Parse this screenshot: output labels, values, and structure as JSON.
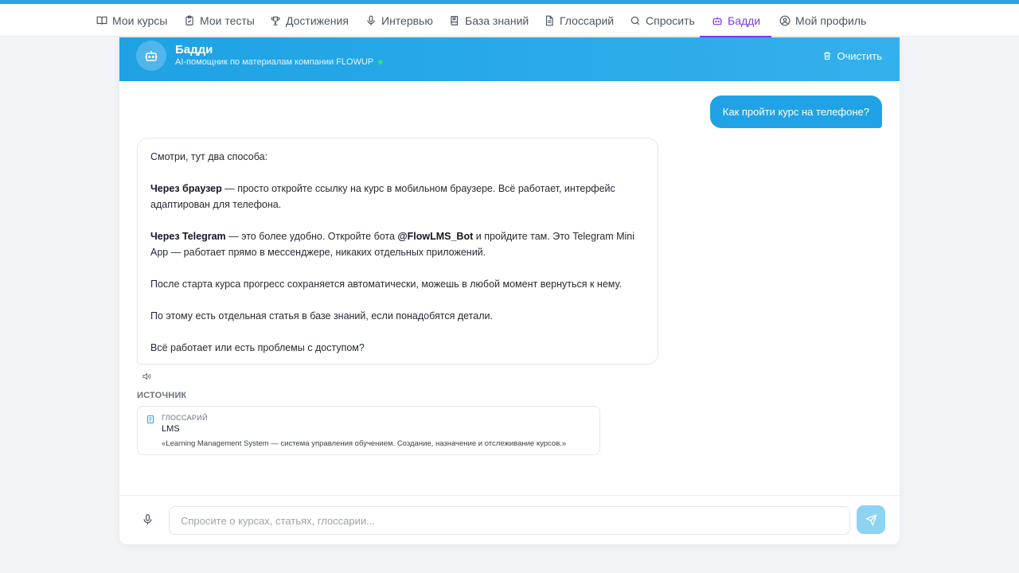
{
  "nav": {
    "items": [
      {
        "label": "Мои курсы",
        "icon": "book-open-icon"
      },
      {
        "label": "Мои тесты",
        "icon": "clipboard-check-icon"
      },
      {
        "label": "Достижения",
        "icon": "trophy-icon"
      },
      {
        "label": "Интервью",
        "icon": "microphone-icon"
      },
      {
        "label": "База знаний",
        "icon": "book-icon"
      },
      {
        "label": "Глоссарий",
        "icon": "file-text-icon"
      },
      {
        "label": "Спросить",
        "icon": "search-icon"
      },
      {
        "label": "Бадди",
        "icon": "bot-icon"
      },
      {
        "label": "Мой профиль",
        "icon": "user-circle-icon"
      }
    ],
    "active_index": 7
  },
  "chat": {
    "bot_name": "Бадди",
    "bot_subtitle": "AI-помощник по материалам компании FLOWUP",
    "clear_label": "Очистить",
    "user_message": "Как пройти курс на телефоне?",
    "bot_message": {
      "p1": "Смотри, тут два способа:",
      "p2_bold": "Через браузер",
      "p2_rest": " — просто откройте ссылку на курс в мобильном браузере. Всё работает, интерфейс адаптирован для телефона.",
      "p3_bold": "Через Telegram",
      "p3_mid": " — это более удобно. Откройте бота ",
      "p3_bot": "@FlowLMS_Bot",
      "p3_rest": " и пройдите там. Это Telegram Mini App — работает прямо в мессенджере, никаких отдельных приложений.",
      "p4": "После старта курса прогресс сохраняется автоматически, можешь в любой момент вернуться к нему.",
      "p5": "По этому есть отдельная статья в базе знаний, если понадобятся детали.",
      "p6": "Всё работает или есть проблемы с доступом?"
    },
    "source_label": "ИСТОЧНИК",
    "source": {
      "type": "ГЛОССАРИЙ",
      "title": "LMS",
      "description": "«Learning Management System — система управления обучением. Создание, назначение и отслеживание курсов.»"
    },
    "input_placeholder": "Спросите о курсах, статьях, глоссарии...",
    "input_value": ""
  },
  "colors": {
    "accent": "#1fa3e6",
    "active_nav": "#7c3aed",
    "online": "#2ee07a"
  }
}
